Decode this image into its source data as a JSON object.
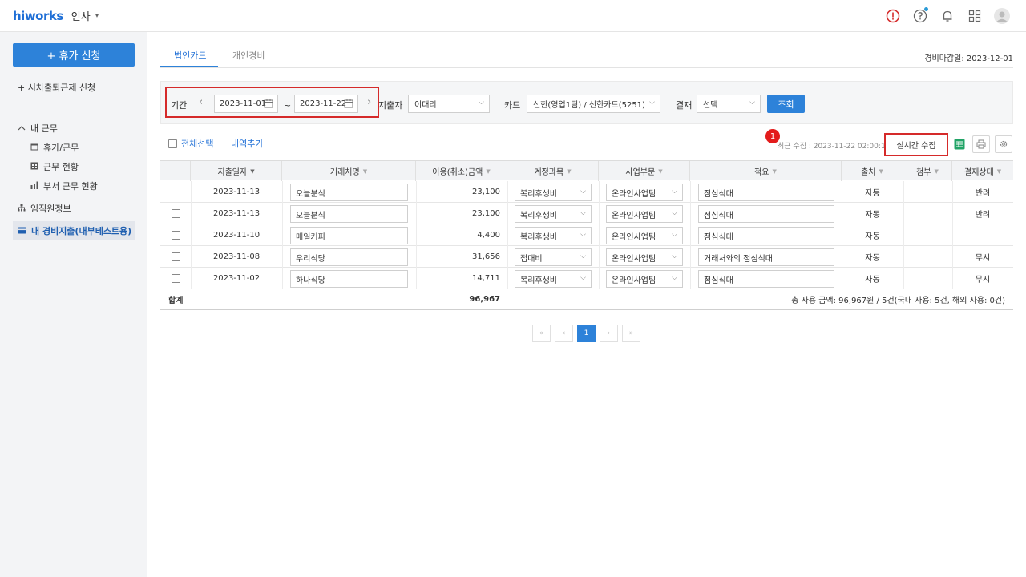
{
  "topbar": {
    "logo": "hiworks",
    "app_name": "인사",
    "app_caret": "▾"
  },
  "sidebar": {
    "primary_button": "+ 휴가 신청",
    "flex_request": "+  시차출퇴근제 신청",
    "my_work_section": "내 근무",
    "items": [
      "휴가/근무",
      "근무 현황",
      "부서 근무 현황"
    ],
    "employee_info": "임직원정보",
    "active_item": "내 경비지출(내부테스트용)"
  },
  "main": {
    "tabs": [
      "법인카드",
      "개인경비"
    ],
    "deadline": "경비마감일: 2023-12-01",
    "filter": {
      "period_label": "기간",
      "date_from": "2023-11-01",
      "date_sep": "~",
      "date_to": "2023-11-22",
      "spender_label": "지출자",
      "spender_value": "이대리",
      "card_label": "카드",
      "card_value": "신한(영업1팀) / 신한카드(5251)",
      "approval_label": "결재",
      "approval_value": "선택",
      "search_button": "조회"
    },
    "toolbar": {
      "select_all": "전체선택",
      "add_item": "내역추가",
      "badge": "1",
      "recent": "최근 수집 : 2023-11-22 02:00:13",
      "realtime_button": "실시간 수집"
    },
    "table": {
      "headers": [
        "지출일자",
        "거래처명",
        "이용(취소)금액",
        "계정과목",
        "사업부문",
        "적요",
        "출처",
        "첨부",
        "결재상태"
      ],
      "rows": [
        {
          "date": "2023-11-13",
          "vendor": "오늘분식",
          "amount": "23,100",
          "account": "복리후생비",
          "division": "온라인사업팀",
          "memo": "점심식대",
          "source": "자동",
          "attach": "",
          "status": "반려"
        },
        {
          "date": "2023-11-13",
          "vendor": "오늘분식",
          "amount": "23,100",
          "account": "복리후생비",
          "division": "온라인사업팀",
          "memo": "점심식대",
          "source": "자동",
          "attach": "",
          "status": "반려"
        },
        {
          "date": "2023-11-10",
          "vendor": "매일커피",
          "amount": "4,400",
          "account": "복리후생비",
          "division": "온라인사업팀",
          "memo": "점심식대",
          "source": "자동",
          "attach": "",
          "status": ""
        },
        {
          "date": "2023-11-08",
          "vendor": "우리식당",
          "amount": "31,656",
          "account": "접대비",
          "division": "온라인사업팀",
          "memo": "거래처와의 점심식대",
          "source": "자동",
          "attach": "",
          "status": "무시"
        },
        {
          "date": "2023-11-02",
          "vendor": "하나식당",
          "amount": "14,711",
          "account": "복리후생비",
          "division": "온라인사업팀",
          "memo": "점심식대",
          "source": "자동",
          "attach": "",
          "status": "무시"
        }
      ],
      "total_label": "합계",
      "total_amount": "96,967",
      "summary": "총 사용 금액: 96,967원 / 5건(국내 사용: 5건, 해외 사용: 0건)"
    },
    "pager": {
      "first": "«",
      "prev": "‹",
      "current": "1",
      "next": "›",
      "last": "»"
    }
  },
  "colors": {
    "accent": "#2d82d9",
    "highlight": "#d52a2a"
  }
}
